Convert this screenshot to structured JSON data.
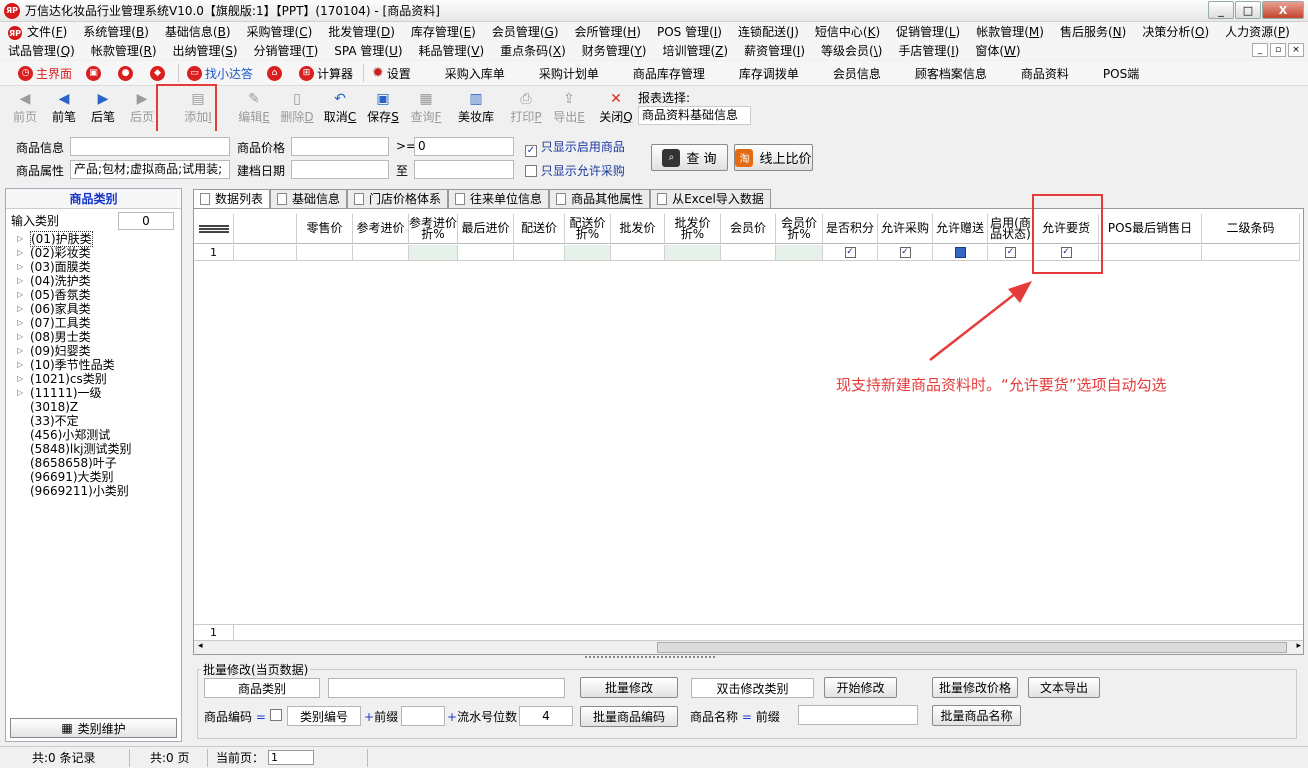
{
  "window": {
    "title": "万信达化妆品行业管理系统V10.0【旗舰版:1】【PPT】(170104) - [商品资料]",
    "logo": "ЯP",
    "controls": [
      "_",
      "□",
      "X"
    ]
  },
  "menu_row1": [
    {
      "label": "文件(",
      "key": "F",
      "end": ")"
    },
    {
      "label": "系统管理(",
      "key": "B",
      "end": ")"
    },
    {
      "label": "基础信息(",
      "key": "B",
      "end": ")"
    },
    {
      "label": "采购管理(",
      "key": "C",
      "end": ")"
    },
    {
      "label": "批发管理(",
      "key": "D",
      "end": ")"
    },
    {
      "label": "库存管理(",
      "key": "E",
      "end": ")"
    },
    {
      "label": "会员管理(",
      "key": "G",
      "end": ")"
    },
    {
      "label": "会所管理(",
      "key": "H",
      "end": ")"
    },
    {
      "label": "POS 管理(",
      "key": "I",
      "end": ")"
    },
    {
      "label": "连锁配送(",
      "key": "J",
      "end": ")"
    },
    {
      "label": "短信中心(",
      "key": "K",
      "end": ")"
    },
    {
      "label": "促销管理(",
      "key": "L",
      "end": ")"
    },
    {
      "label": "帐款管理(",
      "key": "M",
      "end": ")"
    },
    {
      "label": "售后服务(",
      "key": "N",
      "end": ")"
    },
    {
      "label": "决策分析(",
      "key": "O",
      "end": ")"
    },
    {
      "label": "人力资源(",
      "key": "P",
      "end": ")"
    }
  ],
  "menu_row2": [
    {
      "label": "试品管理(",
      "key": "Q",
      "end": ")"
    },
    {
      "label": "帐款管理(",
      "key": "R",
      "end": ")"
    },
    {
      "label": "出纳管理(",
      "key": "S",
      "end": ")"
    },
    {
      "label": "分销管理(",
      "key": "T",
      "end": ")"
    },
    {
      "label": "SPA 管理(",
      "key": "U",
      "end": ")"
    },
    {
      "label": "耗品管理(",
      "key": "V",
      "end": ")"
    },
    {
      "label": "重点条码(",
      "key": "X",
      "end": ")"
    },
    {
      "label": "财务管理(",
      "key": "Y",
      "end": ")"
    },
    {
      "label": "培训管理(",
      "key": "Z",
      "end": ")"
    },
    {
      "label": "薪资管理(",
      "key": "I",
      "end": ")"
    },
    {
      "label": "等级会员(",
      "key": "\\",
      "end": ")"
    },
    {
      "label": "手店管理(",
      "key": "I",
      "end": ")"
    },
    {
      "label": "窗体(",
      "key": "W",
      "end": ")"
    }
  ],
  "mdi_controls": [
    "_",
    "▫",
    "×"
  ],
  "quickbar": {
    "home": "主界面",
    "find": "找小达答",
    "calc": "计算器",
    "settings": "设置",
    "links": [
      "采购入库单",
      "采购计划单",
      "商品库存管理",
      "库存调拨单",
      "会员信息",
      "顾客档案信息",
      "商品资料",
      "POS端"
    ]
  },
  "toolbar": {
    "first": "前页",
    "prev": "前笔",
    "next": "后笔",
    "last": "后页",
    "add": "添加",
    "add_key": "I",
    "edit": "编辑",
    "edit_key": "E",
    "delete": "删除",
    "delete_key": "D",
    "cancel": "取消",
    "cancel_key": "C",
    "save": "保存",
    "save_key": "S",
    "query": "查询",
    "query_key": "F",
    "cosmetics": "美妆库",
    "print": "打印",
    "print_key": "P",
    "export": "导出",
    "export_key": "E",
    "close": "关闭",
    "close_key": "Q",
    "report_label": "报表选择:",
    "report_value": "商品资料基础信息"
  },
  "filter": {
    "product_info_label": "商品信息",
    "product_price_label": "商品价格",
    "price_op": ">=",
    "price_value": "0",
    "only_enabled_label": "只显示启用商品",
    "only_enabled_checked": "✓",
    "product_attr_label": "商品属性",
    "product_attr_value": "产品;包材;虚拟商品;试用装;",
    "created_label": "建档日期",
    "to_label": "至",
    "only_purchase_label": "只显示允许采购",
    "query_btn": "查 询",
    "compare_btn": "线上比价",
    "compare_icon": "淘"
  },
  "left_panel": {
    "title": "商品类别",
    "input_label": "输入类别",
    "count": "0",
    "categories": [
      "(01)护肤类",
      "(02)彩妆类",
      "(03)面膜类",
      "(04)洗护类",
      "(05)香氛类",
      "(06)家具类",
      "(07)工具类",
      "(08)男士类",
      "(09)妇婴类",
      "(10)季节性品类",
      "(1021)cs类别",
      "(11111)一级",
      "(3018)Z",
      "(33)不定",
      "(456)小郑测试",
      "(5848)lkj测试类别",
      "(8658658)叶子",
      "(96691)大类别",
      "(9669211)小类别"
    ],
    "maintain_btn": "类别维护"
  },
  "tabs": [
    "数据列表",
    "基础信息",
    "门店价格体系",
    "往来单位信息",
    "商品其他属性",
    "从Excel导入数据"
  ],
  "grid": {
    "columns": [
      {
        "label": "",
        "w": 40
      },
      {
        "label": "",
        "w": 63
      },
      {
        "label": "零售价",
        "w": 56
      },
      {
        "label": "参考进价",
        "w": 56
      },
      {
        "label": "参考进价折%",
        "w": 49
      },
      {
        "label": "最后进价",
        "w": 56
      },
      {
        "label": "配送价",
        "w": 51
      },
      {
        "label": "配送价折%",
        "w": 46
      },
      {
        "label": "批发价",
        "w": 54
      },
      {
        "label": "批发价折%",
        "w": 56
      },
      {
        "label": "会员价",
        "w": 55
      },
      {
        "label": "会员价折%",
        "w": 47
      },
      {
        "label": "是否积分",
        "w": 55
      },
      {
        "label": "允许采购",
        "w": 55
      },
      {
        "label": "允许赠送",
        "w": 55
      },
      {
        "label": "启用(商品状态)",
        "w": 46
      },
      {
        "label": "允许要货",
        "w": 65
      },
      {
        "label": "POS最后销售日",
        "w": 103
      },
      {
        "label": "二级条码",
        "w": 98
      }
    ],
    "row_index": "1",
    "footer_index": "1",
    "checks": {
      "score": "✓",
      "purchase": "✓",
      "gift": "",
      "enabled": "✓",
      "order": "✓"
    },
    "scroll_left": "◂",
    "scroll_right": "▸"
  },
  "annotation": "现支持新建商品资料时。“允许要货”选项自动勾选",
  "batch": {
    "title": "批量修改(当页数据)",
    "category_field": "商品类别",
    "batch_edit_btn": "批量修改",
    "dblclick_field": "双击修改类别",
    "start_edit_btn": "开始修改",
    "batch_price_btn": "批量修改价格",
    "export_text_btn": "文本导出",
    "code_label": "商品编码",
    "eq": "=",
    "category_code_field": "类别编号",
    "plus": "+",
    "prefix_label": "前缀",
    "serial_label": "流水号位数",
    "serial_value": "4",
    "batch_code_btn": "批量商品编码",
    "name_label": "商品名称",
    "batch_name_btn": "批量商品名称"
  },
  "status": {
    "records": "共:0 条记录",
    "pages": "共:0 页",
    "current_label": "当前页：",
    "current_value": "1"
  },
  "colors": {
    "accent_red": "#e53b3b",
    "link_blue": "#1a56c8"
  }
}
